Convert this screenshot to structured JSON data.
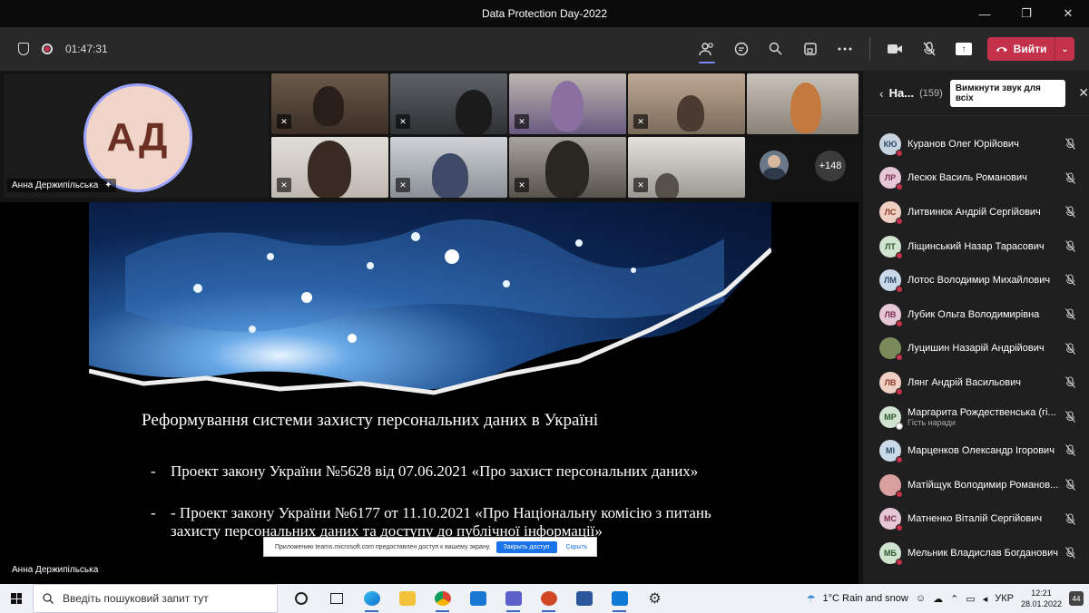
{
  "window": {
    "title": "Data Protection Day-2022",
    "minimize": "—",
    "restore": "❐",
    "close": "✕"
  },
  "toolbar": {
    "timer": "01:47:31",
    "leave_label": "Вийти"
  },
  "stage": {
    "speaker_initials": "АД",
    "speaker_name": "Анна Держипільська",
    "more_count": "+148",
    "presenter_name": "Анна Держипільська"
  },
  "slide": {
    "title": "Реформування системи захисту персональних даних в Україні",
    "bullets": [
      {
        "dash": "-",
        "text": "Проект закону України №5628 від 07.06.2021 «Про захист персональних даних»"
      },
      {
        "dash": "-",
        "text": "- Проект закону України №6177 от 11.10.2021 «Про Національну комісію з питань захисту персональних даних та доступу до публічної інформації»"
      }
    ]
  },
  "share_bar": {
    "message": "Приложению teams.microsoft.com предоставлен доступ к вашему экрану.",
    "stop_label": "Закрыть доступ",
    "hide_label": "Скрыть"
  },
  "panel": {
    "title": "На...",
    "count": "(159)",
    "mute_all": "Вимкнути звук для всіх",
    "participants": [
      {
        "initials": "КЮ",
        "name": "Куранов Олег Юрійович",
        "bg": "#c7d4e0",
        "fg": "#2b4a66"
      },
      {
        "initials": "ЛР",
        "name": "Лесюк Василь Романович",
        "bg": "#e6c7d5",
        "fg": "#7a2e50"
      },
      {
        "initials": "ЛС",
        "name": "Литвинюк Андрій Сергійович",
        "bg": "#f0cfc4",
        "fg": "#8a3a22"
      },
      {
        "initials": "ЛТ",
        "name": "Ліщинський Назар Тарасович",
        "bg": "#cfe3cf",
        "fg": "#2d5a2d"
      },
      {
        "initials": "ЛМ",
        "name": "Лотос Володимир Михайлович",
        "bg": "#c9d9e8",
        "fg": "#2b4a66"
      },
      {
        "initials": "ЛВ",
        "name": "Лубик Ольга Володимирівна",
        "bg": "#e6c7d5",
        "fg": "#7a2e50"
      },
      {
        "initials": "",
        "name": "Луцишин Назарій Андрійович",
        "bg": "#7a8a5a",
        "fg": "#ffffff"
      },
      {
        "initials": "ЛВ",
        "name": "Лянг Андрій Васильович",
        "bg": "#f0cfc4",
        "fg": "#8a3a22"
      },
      {
        "initials": "МР",
        "name": "Маргарита Рождественська (гі...",
        "sub": "Гість наради",
        "bg": "#cfe3cf",
        "fg": "#2d5a2d",
        "away": true
      },
      {
        "initials": "МІ",
        "name": "Марценков Олександр Ігорович",
        "bg": "#c9d9e8",
        "fg": "#2b4a66"
      },
      {
        "initials": "",
        "name": "Матійщук Володимир Романов...",
        "bg": "#d9a0a0",
        "fg": "#ffffff"
      },
      {
        "initials": "МС",
        "name": "Матненко Віталій Сергійович",
        "bg": "#e6c7d5",
        "fg": "#7a2e50"
      },
      {
        "initials": "МБ",
        "name": "Мельник Владислав Богданович",
        "bg": "#cfe3cf",
        "fg": "#2d5a2d"
      }
    ]
  },
  "taskbar": {
    "search_placeholder": "Введіть пошуковий запит тут",
    "weather": "1°C  Rain and snow",
    "language": "УКР",
    "time": "12:21",
    "date": "28.01.2022",
    "notifications": "44"
  }
}
